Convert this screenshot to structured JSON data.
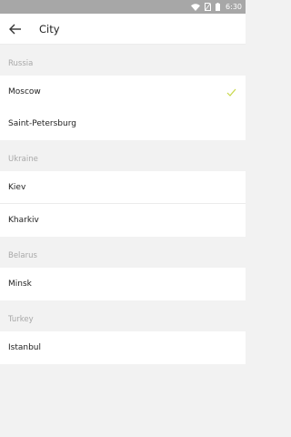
{
  "status_bar": {
    "time": "6:30",
    "icons": [
      "wifi-icon",
      "no-sim-icon",
      "battery-icon"
    ]
  },
  "app_bar": {
    "back_icon": "arrow-left-icon",
    "title": "City"
  },
  "sections": [
    {
      "country": "Russia",
      "cities": [
        {
          "name": "Moscow",
          "selected": true
        },
        {
          "name": "Saint-Petersburg",
          "selected": false
        }
      ]
    },
    {
      "country": "Ukraine",
      "cities": [
        {
          "name": "Kiev",
          "selected": false
        },
        {
          "name": "Kharkiv",
          "selected": false
        }
      ]
    },
    {
      "country": "Belarus",
      "cities": [
        {
          "name": "Minsk",
          "selected": false
        }
      ]
    },
    {
      "country": "Turkey",
      "cities": [
        {
          "name": "Istanbul",
          "selected": false
        }
      ]
    }
  ],
  "colors": {
    "accent_check": "#c8d84a",
    "status_bar": "#a7a7a7",
    "section_header_text": "#a8a8a8"
  }
}
